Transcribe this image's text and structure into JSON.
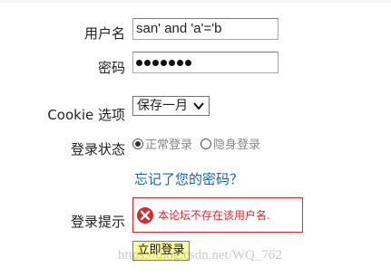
{
  "form": {
    "username_label": "用户名",
    "username_value": "san' and 'a'='b",
    "password_label": "密码",
    "password_dot_count": 7,
    "cookie_label": "Cookie 选项",
    "cookie_selected": "保存一月",
    "status_label": "登录状态",
    "status_options": [
      "正常登录",
      "隐身登录"
    ],
    "status_selected": "正常登录",
    "forgot_link": "忘记了您的密码？",
    "tip_label": "登录提示",
    "error_message": "本论坛不存在该用户名.",
    "submit_label": "立即登录"
  },
  "watermark": "https://blog.csdn.net/WQ_762",
  "colors": {
    "link": "#1a62b6",
    "error": "#d9272d",
    "button_bg": "#ffff99"
  },
  "icons": {
    "error": "error-x-icon",
    "select_caret": "chevron-down-icon"
  }
}
